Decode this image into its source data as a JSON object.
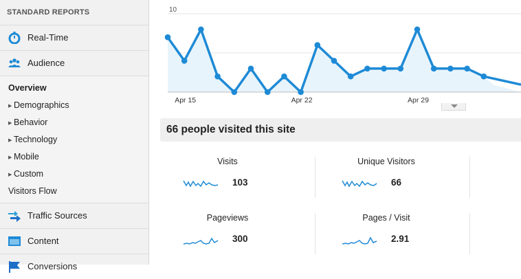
{
  "sidebar": {
    "header": "STANDARD REPORTS",
    "realtime": "Real-Time",
    "audience": "Audience",
    "audience_items": [
      {
        "label": "Overview"
      },
      {
        "label": "Demographics"
      },
      {
        "label": "Behavior"
      },
      {
        "label": "Technology"
      },
      {
        "label": "Mobile"
      },
      {
        "label": "Custom"
      },
      {
        "label": "Visitors Flow"
      }
    ],
    "traffic_sources": "Traffic Sources",
    "content": "Content",
    "conversions": "Conversions"
  },
  "colors": {
    "accent": "#1e8ad6",
    "area_fill": "#e8f4fb",
    "realtime_icon": "#1e8ad6",
    "audience_icon": "#1e8ad6",
    "traffic_icon": "#2aa0d8",
    "conversions_icon": "#1e6fc6"
  },
  "icons": {
    "realtime": "stopwatch-icon",
    "audience": "people-icon",
    "traffic": "arrows-icon",
    "content": "window-icon",
    "conversions": "flag-icon"
  },
  "chart_data": {
    "type": "line",
    "y_ticks": [
      "10",
      "5"
    ],
    "x_tick_labels": [
      "Apr 15",
      "Apr 22",
      "Apr 29"
    ],
    "ylim": [
      0,
      10
    ],
    "grid": true,
    "values": [
      7,
      4,
      8,
      2,
      0,
      3,
      0,
      2,
      0,
      6,
      4,
      2,
      3,
      3,
      3,
      8,
      3,
      3,
      3,
      2
    ]
  },
  "summary": {
    "headline": "66 people visited this site"
  },
  "metrics": [
    {
      "label": "Visits",
      "value": "103"
    },
    {
      "label": "Unique Visitors",
      "value": "66"
    },
    {
      "label": "Pageviews",
      "value": "300"
    },
    {
      "label": "Pages / Visit",
      "value": "2.91"
    }
  ]
}
